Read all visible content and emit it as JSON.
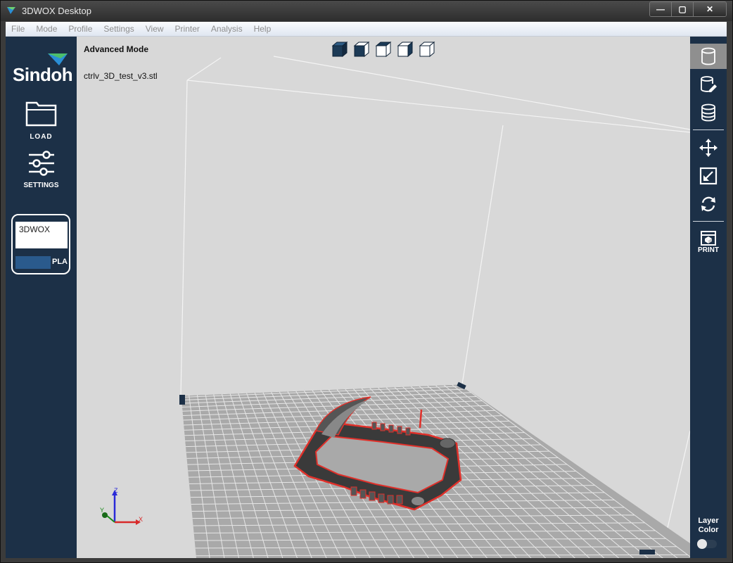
{
  "window": {
    "title": "3DWOX Desktop",
    "controls": [
      "—",
      "▢",
      "✕"
    ]
  },
  "menu": [
    "File",
    "Mode",
    "Profile",
    "Settings",
    "View",
    "Printer",
    "Analysis",
    "Help"
  ],
  "left": {
    "logo": "Sindoh",
    "load_label": "LOAD",
    "settings_label": "SETTINGS",
    "printer_name": "3DWOX",
    "material": "PLA"
  },
  "viewport": {
    "mode": "Advanced Mode",
    "file": "ctrlv_3D_test_v3.stl",
    "axes": {
      "z": "Z",
      "y": "Y",
      "x": "X"
    }
  },
  "right": {
    "print_label": "PRINT",
    "layer_color_line1": "Layer",
    "layer_color_line2": "Color"
  },
  "colors": {
    "panel": "#1c3047",
    "model_outline": "#e0302a",
    "model": "#3a3a3a"
  }
}
